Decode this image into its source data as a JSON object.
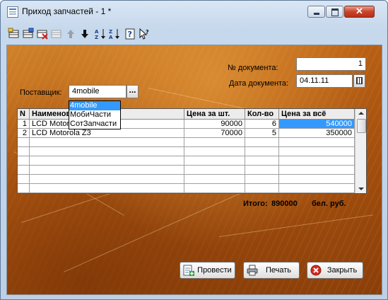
{
  "window": {
    "title": "Приход запчастей - 1 *",
    "close_glyph": "✕"
  },
  "toolbar": {
    "items": [
      {
        "icon": "new-row-icon",
        "enabled": true
      },
      {
        "icon": "edit-row-icon",
        "enabled": true
      },
      {
        "icon": "delete-row-icon",
        "enabled": true
      },
      {
        "icon": "copy-row-icon",
        "enabled": false
      },
      {
        "icon": "arrow-up-icon",
        "enabled": false
      },
      {
        "icon": "arrow-down-icon",
        "enabled": true
      },
      {
        "icon": "sort-ascending-icon",
        "enabled": true
      },
      {
        "icon": "sort-descending-icon",
        "enabled": true
      },
      {
        "icon": "help-icon",
        "enabled": true
      },
      {
        "icon": "context-help-icon",
        "enabled": true
      }
    ]
  },
  "form": {
    "doc_number_label": "№ документа:",
    "doc_number": "1",
    "doc_date_label": "Дата документа:",
    "doc_date": "04.11.11",
    "supplier_label": "Поставщик:",
    "supplier_value": "4mobile",
    "supplier_button": "...",
    "supplier_options": [
      "4mobile",
      "МобиЧасти",
      "СотЗапчасти"
    ]
  },
  "table": {
    "columns": [
      "N",
      "Наименование",
      "Цена за шт.",
      "Кол-во",
      "Цена за всё"
    ],
    "rows": [
      [
        "1",
        "LCD Motorola Z3",
        "90000",
        "6",
        "540000"
      ],
      [
        "2",
        "LCD Motorola Z3",
        "70000",
        "5",
        "350000"
      ]
    ],
    "highlight_color": "#3399ff"
  },
  "totals": {
    "label": "Итого:",
    "value": "890000",
    "currency": "бел. руб."
  },
  "buttons": {
    "post": "Провести",
    "print": "Печать",
    "close": "Закрыть"
  },
  "colors": {
    "background_orange": "#b85f14",
    "selection": "#3399ff",
    "close_red": "#c9432c"
  }
}
